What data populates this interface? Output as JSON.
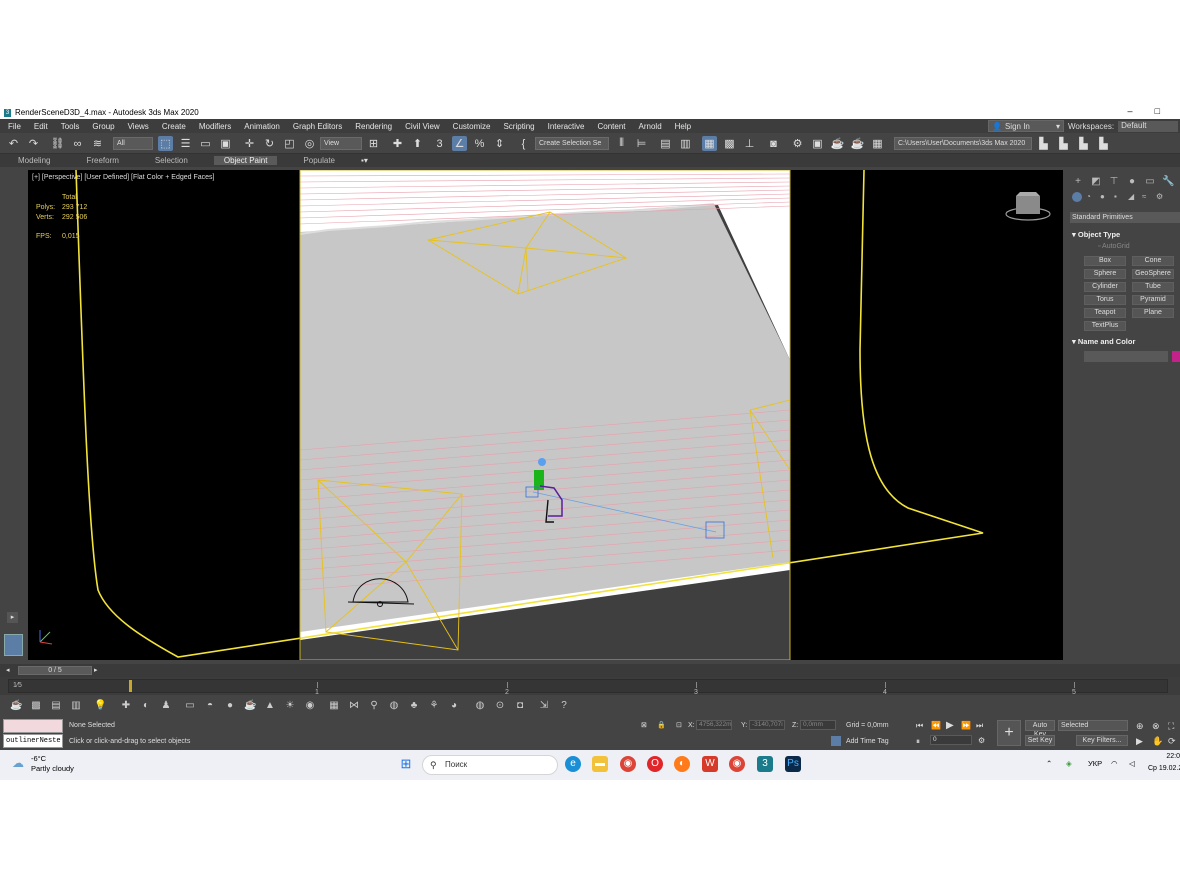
{
  "window": {
    "title": "RenderSceneD3D_4.max - Autodesk 3ds Max 2020",
    "minimize": "–",
    "maximize": "□"
  },
  "menu": [
    "File",
    "Edit",
    "Tools",
    "Group",
    "Views",
    "Create",
    "Modifiers",
    "Animation",
    "Graph Editors",
    "Rendering",
    "Civil View",
    "Customize",
    "Scripting",
    "Interactive",
    "Content",
    "Arnold",
    "Help"
  ],
  "account": {
    "sign_in": "Sign In",
    "workspaces_label": "Workspaces:",
    "workspace_value": "Default"
  },
  "toolbar": {
    "filter_value": "All",
    "coord_value": "View",
    "selection_set": "Create Selection Se",
    "path": "C:\\Users\\User\\Documents\\3ds Max 2020",
    "snap_label": "3",
    "angle_label": "%"
  },
  "ribbon": {
    "tabs": [
      "Modeling",
      "Freeform",
      "Selection",
      "Object Paint",
      "Populate"
    ],
    "active": "Object Paint"
  },
  "viewport": {
    "label": "[+] [Perspective] [User Defined] [Flat Color + Edged Faces]",
    "stats": {
      "total_label": "Total",
      "polys_label": "Polys:",
      "polys_value": "293 712",
      "verts_label": "Verts:",
      "verts_value": "292 506",
      "fps_label": "FPS:",
      "fps_value": "0,015"
    }
  },
  "command_panel": {
    "category": "Standard Primitives",
    "object_type_title": "Object Type",
    "autogrid": "AutoGrid",
    "buttons": [
      "Box",
      "Cone",
      "Sphere",
      "GeoSphere",
      "Cylinder",
      "Tube",
      "Torus",
      "Pyramid",
      "Teapot",
      "Plane",
      "TextPlus"
    ],
    "name_color_title": "Name and Color",
    "object_color": "#c2228a"
  },
  "timeline": {
    "slider": "0 / 5",
    "ruler_ticks": [
      "1",
      "2",
      "3",
      "4",
      "5"
    ],
    "frame_label": "1⁄5"
  },
  "status": {
    "outliner_text": "outlinerNeste",
    "selection": "None Selected",
    "prompt": "Click or click-and-drag to select objects",
    "x_label": "X:",
    "x_value": "4756,322m",
    "y_label": "Y:",
    "y_value": "-3140,707i",
    "z_label": "Z:",
    "z_value": "0,0mm",
    "grid": "Grid = 0,0mm",
    "add_time_tag": "Add Time Tag",
    "auto_key": "Auto Key",
    "set_key": "Set Key",
    "selected": "Selected",
    "key_filters": "Key Filters...",
    "frame_value": "0"
  },
  "taskbar": {
    "temp": "-6°C",
    "weather": "Partly cloudy",
    "search_placeholder": "Поиск",
    "lang": "УКР",
    "time": "22:0",
    "date": "Ср 19.02.2"
  }
}
